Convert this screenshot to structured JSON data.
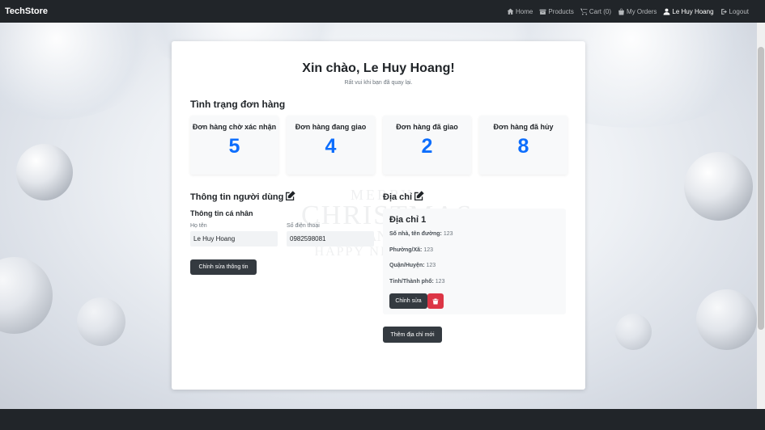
{
  "navbar": {
    "brand": "TechStore",
    "links": {
      "home": "Home",
      "products": "Products",
      "cart": "Cart (0)",
      "orders": "My Orders",
      "user": "Le Huy Hoang",
      "logout": "Logout"
    }
  },
  "greeting": {
    "title": "Xin chào, Le Huy Hoang!",
    "subtitle": "Rất vui khi bạn đã quay lại."
  },
  "order_status": {
    "heading": "Tình trạng đơn hàng",
    "cards": [
      {
        "label": "Đơn hàng chờ xác nhận",
        "count": "5"
      },
      {
        "label": "Đơn hàng đang giao",
        "count": "4"
      },
      {
        "label": "Đơn hàng đã giao",
        "count": "2"
      },
      {
        "label": "Đơn hàng đã hủy",
        "count": "8"
      }
    ]
  },
  "user_info": {
    "heading": "Thông tin người dùng",
    "personal_heading": "Thông tin cá nhân",
    "name_label": "Họ tên",
    "name_value": "Le Huy Hoang",
    "phone_label": "Số điện thoại",
    "phone_value": "0982598081",
    "edit_button": "Chỉnh sửa thông tin"
  },
  "address": {
    "heading": "Địa chỉ",
    "items": [
      {
        "title": "Địa chỉ 1",
        "street_label": "Số nhà, tên đường:",
        "street": "123",
        "ward_label": "Phường/Xã:",
        "ward": "123",
        "district_label": "Quận/Huyện:",
        "district": "123",
        "city_label": "Tỉnh/Thành phố:",
        "city": "123",
        "edit_button": "Chỉnh sửa"
      }
    ],
    "add_button": "Thêm địa chỉ mới"
  },
  "background_text": {
    "line1": "MERRY",
    "line2": "CHRISTMAS",
    "line3": "AND",
    "line4": "HAPPY NEW YEAR"
  },
  "colors": {
    "navbar": "#212529",
    "accent_number": "#0d6efd",
    "danger": "#dc3545",
    "button_dark": "#343a40"
  }
}
